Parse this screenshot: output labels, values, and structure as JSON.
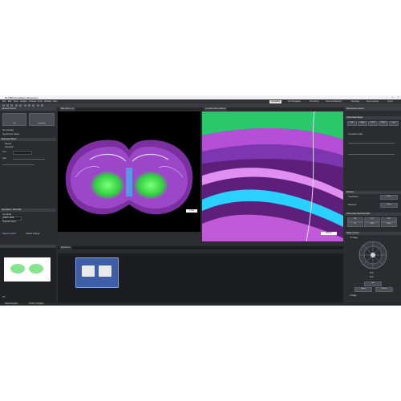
{
  "app": {
    "title": "OLYMPUS cellSens Dimension"
  },
  "menu": [
    "File",
    "Edit",
    "View",
    "Acquire",
    "Process",
    "Tools",
    "Window",
    "Help"
  ],
  "workspaces": [
    "Acquisition",
    "Well Navigation",
    "Processing",
    "Count and Measure",
    "Reporting",
    "Deep Learning",
    "Layout"
  ],
  "left": {
    "camera_control": "Camera Control",
    "live_label": "Live",
    "snapshot_label": "Snapshot",
    "no_recording": "No recording",
    "synchronize_shutter": "Synchronize shutter",
    "exposure_title": "Exposure Wheel",
    "manual": "Manual",
    "automatic": "Automatic",
    "time_label": "Time",
    "gain_label": "Gain",
    "resolution_title": "Resolution / ROI & Bit",
    "live_mode": "Live Mode",
    "live_value": "2048 x 2048",
    "snapshot_mode": "Snapshot Mode",
    "tab_camera": "Camera Control",
    "tab_sample": "Sample Settings",
    "navigator_zoom": "5%",
    "bottom_tabs": [
      "Stage Navigator",
      "Position Navigator"
    ]
  },
  "documents": {
    "tab1": "Brain slice 1.vsi",
    "tab2": "Cerebral cortex detail.vsi",
    "scale1": "1 mm",
    "scale2": "200 µm"
  },
  "experiment": {
    "tab": "Experiment"
  },
  "right": {
    "microscope_title": "Microscope Control",
    "observation_title": "Observation Mode",
    "obs_buttons": [
      "BF",
      "DAPI",
      "FITC",
      "TRITC",
      "Cy5"
    ],
    "correction_collar": "Correction Collar",
    "shutter_title": "Shutters",
    "transmitted": "Transmitted",
    "reflected": "Reflected",
    "close": "Close",
    "methods_title": "Observation Methods (BF)",
    "method_buttons": [
      "BF",
      "DF",
      "DIC",
      "FL",
      "TIRF",
      "Other"
    ],
    "stage_title": "Stage Control",
    "xy_stage": "XY-Stage",
    "z_stage": "Z-Stage",
    "fast": "Fast",
    "fine": "Fine",
    "set_label": "Set",
    "home_label": "Home",
    "center_label": "Center"
  },
  "colors": {
    "accent": "#2f6fd6",
    "green": "#35e04a",
    "magenta": "#c24ce0",
    "cyan": "#2ad0ff"
  }
}
